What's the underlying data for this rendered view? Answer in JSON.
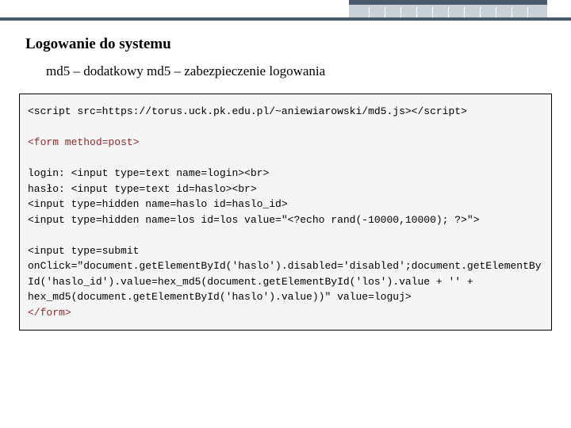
{
  "header": {
    "title": "Logowanie do systemu",
    "subtitle": "md5 – dodatkowy md5 – zabezpieczenie logowania"
  },
  "code": {
    "line1": "<script src=https://torus.uck.pk.edu.pl/~aniewiarowski/md5.js></script>",
    "line2": "",
    "line3_open": "<form method=post>",
    "line4": "",
    "line5": "login: <input type=text name=login><br>",
    "line6": "hasło: <input type=text id=haslo><br>",
    "line7": "<input type=hidden name=haslo id=haslo_id>",
    "line8": "<input type=hidden name=los id=los value=\"<?echo rand(-10000,10000); ?>\">",
    "line9": "",
    "line10": "<input type=submit",
    "line11": "onClick=\"document.getElementById('haslo').disabled='disabled';document.getElementById('haslo_id').value=hex_md5(document.getElementById('los').value + '' + hex_md5(document.getElementById('haslo').value))\" value=loguj>",
    "line12_close": "</form>"
  }
}
